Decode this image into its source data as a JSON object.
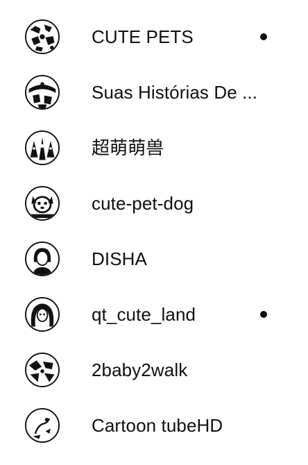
{
  "channels": [
    {
      "name": "CUTE PETS",
      "new_content": true,
      "avatar": "pet-collage-avatar"
    },
    {
      "name": "Suas Histórias De ...",
      "new_content": false,
      "avatar": "story-avatar"
    },
    {
      "name": "超萌萌兽",
      "new_content": false,
      "avatar": "cute-beast-avatar"
    },
    {
      "name": "cute-pet-dog",
      "new_content": false,
      "avatar": "dog-avatar"
    },
    {
      "name": "DISHA",
      "new_content": false,
      "avatar": "person-avatar"
    },
    {
      "name": "qt_cute_land",
      "new_content": true,
      "avatar": "girl-avatar"
    },
    {
      "name": "2baby2walk",
      "new_content": false,
      "avatar": "baby-avatar"
    },
    {
      "name": "Cartoon tubeHD",
      "new_content": false,
      "avatar": "cartoon-avatar"
    }
  ],
  "colors": {
    "text": "#0f0f0f",
    "background": "#ffffff",
    "indicator": "#0f0f0f"
  }
}
